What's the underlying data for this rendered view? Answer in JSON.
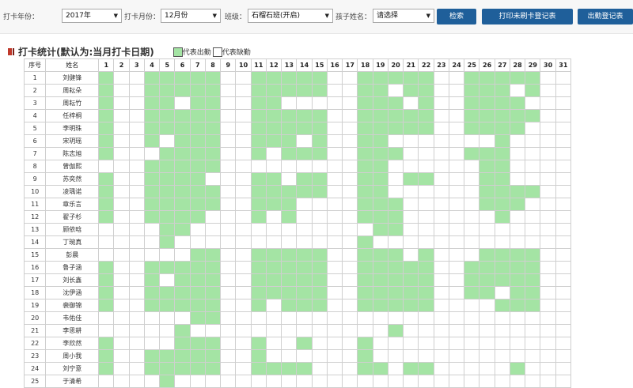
{
  "filters": {
    "year_label": "打卡年份：",
    "year_value": "2017年",
    "month_label": "打卡月份：",
    "month_value": "12月份",
    "class_label": "班级：",
    "class_value": "石榴石班(开启)",
    "child_label": "孩子姓名：",
    "child_value": "请选择",
    "caret": "▼"
  },
  "buttons": {
    "search": "检索",
    "print_unswiped": "打印未刷卡登记表",
    "attendance_register": "出勤登记表"
  },
  "section": {
    "title": "打卡统计(默认为:当月打卡日期)",
    "legend_present": "代表出勤",
    "legend_absent": "代表缺勤"
  },
  "colors": {
    "present": "#a4e4a4",
    "absent": "#ffffff",
    "button": "#1f5f9a",
    "title_mark": "#c0392b"
  },
  "table": {
    "col_seq": "序号",
    "col_name": "姓名",
    "days": [
      "1",
      "2",
      "3",
      "4",
      "5",
      "6",
      "7",
      "8",
      "9",
      "10",
      "11",
      "12",
      "13",
      "14",
      "15",
      "16",
      "17",
      "18",
      "19",
      "20",
      "21",
      "22",
      "23",
      "24",
      "25",
      "26",
      "27",
      "28",
      "29",
      "30",
      "31"
    ],
    "rows": [
      {
        "seq": "1",
        "name": "刘健锋",
        "present": [
          1,
          4,
          5,
          6,
          7,
          8,
          11,
          12,
          13,
          14,
          15,
          18,
          19,
          20,
          21,
          22,
          25,
          26,
          27,
          28,
          29
        ]
      },
      {
        "seq": "2",
        "name": "周耘朵",
        "present": [
          1,
          4,
          5,
          6,
          7,
          8,
          11,
          12,
          13,
          14,
          15,
          18,
          19,
          21,
          22,
          25,
          26,
          27,
          29
        ]
      },
      {
        "seq": "3",
        "name": "周耘竹",
        "present": [
          1,
          4,
          5,
          7,
          8,
          11,
          12,
          18,
          19,
          20,
          22,
          25,
          26,
          27,
          28
        ]
      },
      {
        "seq": "4",
        "name": "任梓桐",
        "present": [
          1,
          4,
          5,
          6,
          7,
          8,
          11,
          12,
          13,
          14,
          15,
          18,
          19,
          20,
          21,
          22,
          25,
          26,
          27,
          28,
          29
        ]
      },
      {
        "seq": "5",
        "name": "李明珠",
        "present": [
          1,
          4,
          5,
          6,
          7,
          8,
          11,
          12,
          13,
          14,
          15,
          18,
          19,
          20,
          21,
          22,
          25,
          26,
          27,
          28
        ]
      },
      {
        "seq": "6",
        "name": "宋玥瑶",
        "present": [
          1,
          4,
          6,
          7,
          8,
          11,
          12,
          13,
          15,
          18,
          19,
          27
        ]
      },
      {
        "seq": "7",
        "name": "陈志旭",
        "present": [
          1,
          5,
          6,
          7,
          8,
          11,
          13,
          14,
          15,
          18,
          19,
          20,
          25,
          26,
          27
        ]
      },
      {
        "seq": "8",
        "name": "曾伽熙",
        "present": [
          4,
          5,
          6,
          7,
          8,
          18,
          19,
          26,
          27
        ]
      },
      {
        "seq": "9",
        "name": "苏奕然",
        "present": [
          1,
          4,
          5,
          6,
          7,
          11,
          12,
          14,
          15,
          18,
          19,
          21,
          22,
          26,
          27
        ]
      },
      {
        "seq": "10",
        "name": "凌瑀诺",
        "present": [
          1,
          4,
          5,
          6,
          7,
          8,
          11,
          12,
          13,
          14,
          15,
          18,
          19,
          26,
          27,
          28,
          29
        ]
      },
      {
        "seq": "11",
        "name": "章乐言",
        "present": [
          1,
          4,
          5,
          6,
          7,
          8,
          11,
          12,
          13,
          18,
          19,
          20,
          26,
          27,
          28
        ]
      },
      {
        "seq": "12",
        "name": "翟子杉",
        "present": [
          1,
          4,
          5,
          6,
          7,
          11,
          13,
          18,
          19,
          20,
          27
        ]
      },
      {
        "seq": "13",
        "name": "顾依晗",
        "present": [
          5,
          6,
          19,
          20
        ]
      },
      {
        "seq": "14",
        "name": "丁琬真",
        "present": [
          5,
          18
        ]
      },
      {
        "seq": "15",
        "name": "彭晨",
        "present": [
          7,
          8,
          11,
          12,
          13,
          14,
          15,
          18,
          19,
          20,
          22,
          26,
          27,
          28,
          29
        ]
      },
      {
        "seq": "16",
        "name": "鲁子涵",
        "present": [
          1,
          4,
          5,
          6,
          7,
          8,
          11,
          12,
          13,
          14,
          15,
          18,
          19,
          20,
          21,
          22,
          25,
          26,
          27,
          28,
          29
        ]
      },
      {
        "seq": "17",
        "name": "刘长鑫",
        "present": [
          1,
          4,
          6,
          7,
          8,
          11,
          12,
          13,
          14,
          15,
          18,
          19,
          20,
          21,
          22,
          25,
          26,
          27,
          28,
          29
        ]
      },
      {
        "seq": "18",
        "name": "沈伊涵",
        "present": [
          1,
          4,
          5,
          6,
          7,
          8,
          11,
          12,
          13,
          14,
          15,
          18,
          19,
          20,
          21,
          22,
          25,
          26,
          28,
          29
        ]
      },
      {
        "seq": "19",
        "name": "裴御锦",
        "present": [
          1,
          4,
          5,
          6,
          7,
          8,
          11,
          13,
          14,
          15,
          18,
          19,
          20,
          21,
          22,
          27,
          28,
          29
        ]
      },
      {
        "seq": "20",
        "name": "韦佑佳",
        "present": [
          7,
          8
        ]
      },
      {
        "seq": "21",
        "name": "李思耕",
        "present": [
          6,
          20
        ]
      },
      {
        "seq": "22",
        "name": "李欣然",
        "present": [
          1,
          6,
          7,
          8,
          11,
          14,
          18
        ]
      },
      {
        "seq": "23",
        "name": "周小我",
        "present": [
          1,
          4,
          5,
          6,
          7,
          8,
          11,
          18
        ]
      },
      {
        "seq": "24",
        "name": "刘宁意",
        "present": [
          1,
          4,
          5,
          6,
          7,
          8,
          11,
          12,
          13,
          14,
          18,
          19,
          21,
          22,
          28
        ]
      },
      {
        "seq": "25",
        "name": "于清希",
        "present": [
          5
        ]
      }
    ]
  }
}
